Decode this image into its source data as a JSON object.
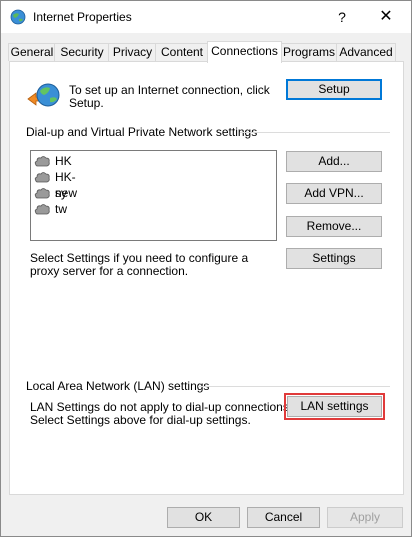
{
  "window": {
    "title": "Internet Properties",
    "help_label": "?",
    "close_label": "✕"
  },
  "tabs": [
    {
      "label": "General"
    },
    {
      "label": "Security"
    },
    {
      "label": "Privacy"
    },
    {
      "label": "Content"
    },
    {
      "label": "Connections",
      "active": true
    },
    {
      "label": "Programs"
    },
    {
      "label": "Advanced"
    }
  ],
  "setup": {
    "text": "To set up an Internet connection, click Setup.",
    "button": "Setup"
  },
  "dialup": {
    "heading": "Dial-up and Virtual Private Network settings",
    "items": [
      "HK",
      "HK-new",
      "sy",
      "tw"
    ],
    "add_button": "Add...",
    "add_vpn_button": "Add VPN...",
    "remove_button": "Remove...",
    "proxy_text": "Select Settings if you need to configure a proxy server for a connection.",
    "settings_button": "Settings"
  },
  "lan": {
    "heading": "Local Area Network (LAN) settings",
    "text_line1": "LAN Settings do not apply to dial-up connections.",
    "text_line2": "Select Settings above for dial-up settings.",
    "button": "LAN settings"
  },
  "footer": {
    "ok": "OK",
    "cancel": "Cancel",
    "apply": "Apply"
  },
  "colors": {
    "focus_border": "#0078d7",
    "highlight": "#e03a3a"
  }
}
